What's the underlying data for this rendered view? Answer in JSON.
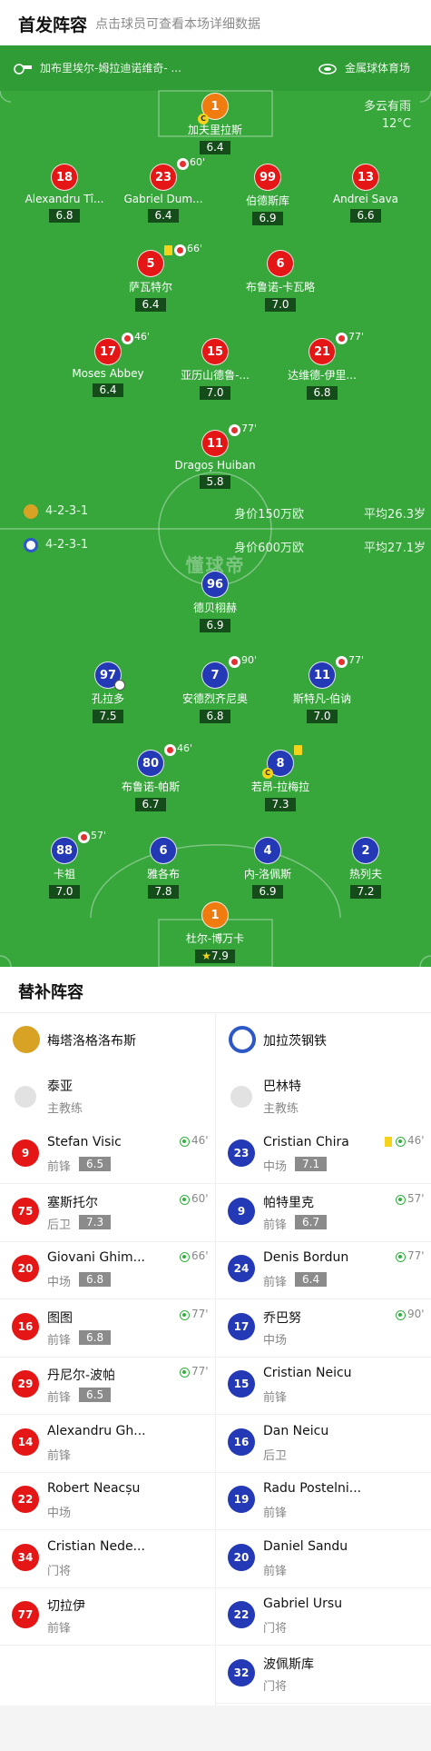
{
  "header": {
    "title": "首发阵容",
    "subtitle": "点击球员可查看本场详细数据"
  },
  "venue": {
    "referee": "加布里埃尔-姆拉迪诺维奇- ...",
    "stadium": "金属球体育场"
  },
  "weather": {
    "condition": "多云有雨",
    "temp": "12°C"
  },
  "watermark": "懂球帝",
  "home_summary": {
    "formation": "4-2-3-1",
    "value": "身价150万欧",
    "age": "平均26.3岁"
  },
  "away_summary": {
    "formation": "4-2-3-1",
    "value": "身价600万欧",
    "age": "平均27.1岁"
  },
  "home_players": {
    "gk": {
      "num": "1",
      "name": "加夫里拉斯",
      "rating": "6.4"
    },
    "d1": {
      "num": "18",
      "name": "Alexandru Tî...",
      "rating": "6.8"
    },
    "d2": {
      "num": "23",
      "name": "Gabriel Dum...",
      "rating": "6.4",
      "sub": "60'"
    },
    "d3": {
      "num": "99",
      "name": "伯德斯库",
      "rating": "6.9"
    },
    "d4": {
      "num": "13",
      "name": "Andrei Sava",
      "rating": "6.6"
    },
    "m1": {
      "num": "5",
      "name": "萨瓦特尔",
      "rating": "6.4",
      "sub": "66'"
    },
    "m2": {
      "num": "6",
      "name": "布鲁诺-卡瓦略",
      "rating": "7.0"
    },
    "a1": {
      "num": "17",
      "name": "Moses Abbey",
      "rating": "6.4",
      "sub": "46'"
    },
    "a2": {
      "num": "15",
      "name": "亚历山德鲁-...",
      "rating": "7.0"
    },
    "a3": {
      "num": "21",
      "name": "达维德-伊里...",
      "rating": "6.8",
      "sub": "77'"
    },
    "st": {
      "num": "11",
      "name": "Dragoș Huiban",
      "rating": "5.8",
      "sub": "77'"
    }
  },
  "away_players": {
    "st": {
      "num": "96",
      "name": "德贝栩赫",
      "rating": "6.9"
    },
    "a1": {
      "num": "97",
      "name": "孔拉多",
      "rating": "7.5"
    },
    "a2": {
      "num": "7",
      "name": "安德烈齐尼奥",
      "rating": "6.8",
      "sub": "90'"
    },
    "a3": {
      "num": "11",
      "name": "斯特凡-伯讷",
      "rating": "7.0",
      "sub": "77'"
    },
    "m1": {
      "num": "80",
      "name": "布鲁诺-帕斯",
      "rating": "6.7",
      "sub": "46'"
    },
    "m2": {
      "num": "8",
      "name": "若昂-拉梅拉",
      "rating": "7.3"
    },
    "d1": {
      "num": "88",
      "name": "卡祖",
      "rating": "7.0",
      "sub": "57'"
    },
    "d2": {
      "num": "6",
      "name": "雅各布",
      "rating": "7.8"
    },
    "d3": {
      "num": "4",
      "name": "内-洛佩斯",
      "rating": "6.9"
    },
    "d4": {
      "num": "2",
      "name": "热列夫",
      "rating": "7.2"
    },
    "gk": {
      "num": "1",
      "name": "杜尔-博万卡",
      "rating": "7.9"
    }
  },
  "subs_title": "替补阵容",
  "home_team": {
    "name": "梅塔洛格洛布斯",
    "coach_name": "泰亚",
    "coach_role": "主教练",
    "subs": [
      {
        "num": "9",
        "name": "Stefan Visic",
        "pos": "前锋",
        "rating": "6.5",
        "min": "46'"
      },
      {
        "num": "75",
        "name": "塞斯托尔",
        "pos": "后卫",
        "rating": "7.3",
        "min": "60'"
      },
      {
        "num": "20",
        "name": "Giovani Ghim...",
        "pos": "中场",
        "rating": "6.8",
        "min": "66'"
      },
      {
        "num": "16",
        "name": "图图",
        "pos": "前锋",
        "rating": "6.8",
        "min": "77'"
      },
      {
        "num": "29",
        "name": "丹尼尔-波帕",
        "pos": "前锋",
        "rating": "6.5",
        "min": "77'"
      },
      {
        "num": "14",
        "name": "Alexandru Gh...",
        "pos": "前锋"
      },
      {
        "num": "22",
        "name": "Robert Neacșu",
        "pos": "中场"
      },
      {
        "num": "34",
        "name": "Cristian Nede...",
        "pos": "门将"
      },
      {
        "num": "77",
        "name": "切拉伊",
        "pos": "前锋"
      }
    ]
  },
  "away_team": {
    "name": "加拉茨钢铁",
    "coach_name": "巴林特",
    "coach_role": "主教练",
    "subs": [
      {
        "num": "23",
        "name": "Cristian Chira",
        "pos": "中场",
        "rating": "7.1",
        "min": "46'",
        "yellow": true
      },
      {
        "num": "9",
        "name": "帕特里克",
        "pos": "前锋",
        "rating": "6.7",
        "min": "57'"
      },
      {
        "num": "24",
        "name": "Denis Bordun",
        "pos": "前锋",
        "rating": "6.4",
        "min": "77'"
      },
      {
        "num": "17",
        "name": "乔巴努",
        "pos": "中场",
        "min": "90'"
      },
      {
        "num": "15",
        "name": "Cristian Neicu",
        "pos": "前锋"
      },
      {
        "num": "16",
        "name": "Dan Neicu",
        "pos": "后卫"
      },
      {
        "num": "19",
        "name": "Radu Postelni...",
        "pos": "前锋"
      },
      {
        "num": "20",
        "name": "Daniel Sandu",
        "pos": "前锋"
      },
      {
        "num": "22",
        "name": "Gabriel Ursu",
        "pos": "门将"
      },
      {
        "num": "32",
        "name": "波佩斯库",
        "pos": "门将"
      }
    ]
  },
  "colors": {
    "pitch": "#37a73c",
    "home": "#e41616",
    "away": "#2339b5",
    "keeper": "#f07c10",
    "sub_in": "#32b140",
    "yellow": "#f5d31a"
  }
}
